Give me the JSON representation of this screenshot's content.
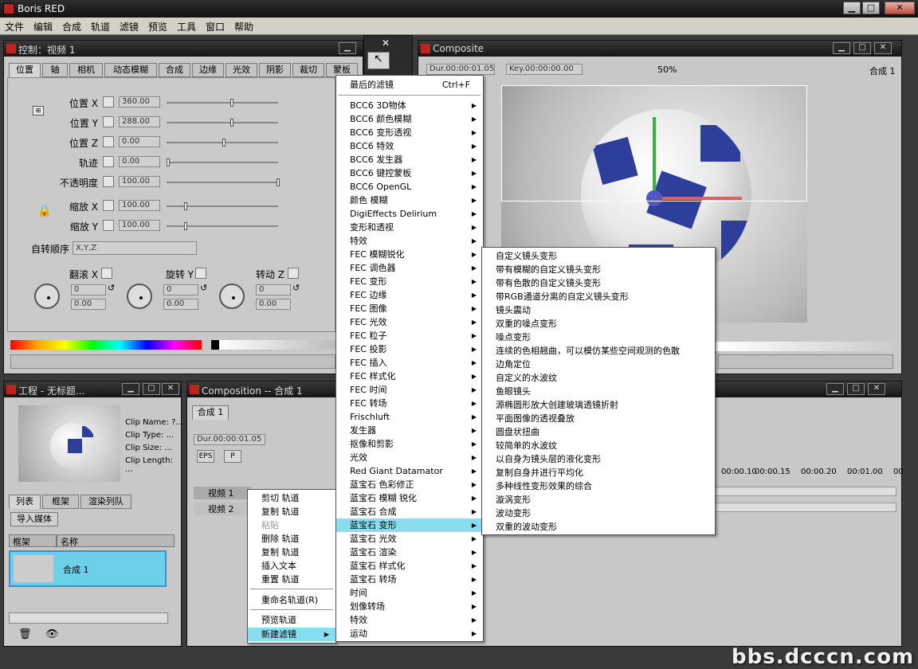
{
  "app": {
    "title": "Boris RED",
    "watermark": "bbs.dcccn.com"
  },
  "menubar": [
    "文件",
    "编辑",
    "合成",
    "轨道",
    "滤镜",
    "预览",
    "工具",
    "窗口",
    "帮助"
  ],
  "control": {
    "title": "控制：视频 1",
    "tabs": [
      "位置",
      "轴",
      "相机",
      "动态模糊",
      "合成",
      "边缘",
      "光效",
      "阴影",
      "裁切",
      "蒙板"
    ],
    "rows": [
      {
        "label": "位置 X",
        "value": "360.00"
      },
      {
        "label": "位置 Y",
        "value": "288.00"
      },
      {
        "label": "位置 Z",
        "value": "0.00"
      },
      {
        "label": "轨迹",
        "value": "0.00"
      },
      {
        "label": "不透明度",
        "value": "100.00"
      },
      {
        "label": "缩放 X",
        "value": "100.00"
      },
      {
        "label": "缩放 Y",
        "value": "100.00"
      }
    ],
    "rot_order_label": "自转顺序",
    "rot_order_value": "X,Y,Z",
    "spins": [
      {
        "label": "翻滚 X",
        "v1": "0",
        "v2": "0.00"
      },
      {
        "label": "旋转 Y",
        "v1": "0",
        "v2": "0.00"
      },
      {
        "label": "转动 Z",
        "v1": "0",
        "v2": "0.00"
      }
    ]
  },
  "composite": {
    "title": "Composite",
    "dur": "Dur.00:00:01.05",
    "key": "Key.00:00:00.00",
    "zoom": "50%",
    "comp": "合成 1"
  },
  "project": {
    "title": "工程 - 无标题...",
    "clip_name": "Clip Name:  ?..",
    "clip_type": "Clip Type:  ...",
    "clip_size": "Clip Size:  ...",
    "clip_length": "Clip Length: ...",
    "tabs": [
      "列表",
      "框架",
      "渲染列队"
    ],
    "import": "导入媒体",
    "col1": "框架",
    "col2": "名称",
    "item": "合成 1"
  },
  "composition": {
    "title": "Composition  --  合成 1",
    "tab": "合成 1",
    "dur": "Dur.00:00:01.05",
    "tracks": [
      "视频 1",
      "视频 2"
    ],
    "timecodes": [
      "00:00.10",
      "00:00.15",
      "00:00.20",
      "00:01.00",
      "00"
    ],
    "toolbar": [
      "EPS",
      "P"
    ]
  },
  "track_menu": {
    "items": [
      "剪切 轨道",
      "复制 轨道",
      "粘贴",
      "删除 轨道",
      "复制 轨道",
      "插入文本",
      "重置 轨道",
      "重命名轨道(R)",
      "预览轨道",
      "新建滤镜"
    ]
  },
  "filter_menu": {
    "first": "最后的滤镜",
    "shortcut": "Ctrl+F",
    "items": [
      "BCC6 3D物体",
      "BCC6 颜色模糊",
      "BCC6 变形透视",
      "BCC6 特效",
      "BCC6 发生器",
      "BCC6 键控蒙板",
      "BCC6 OpenGL",
      "颜色 模糊",
      "DigiEffects Delirium",
      "变形和透视",
      "特效",
      "FEC 模糊锐化",
      "FEC 调色器",
      "FEC 变形",
      "FEC 边缘",
      "FEC 图像",
      "FEC 光效",
      "FEC 粒子",
      "FEC 投影",
      "FEC 插入",
      "FEC 样式化",
      "FEC 时间",
      "FEC 转场",
      "Frischluft",
      "发生器",
      "抠像和剪影",
      "光效",
      "Red Giant Datamator",
      "蓝宝石 色彩修正",
      "蓝宝石 模糊 锐化",
      "蓝宝石 合成",
      "蓝宝石 变形",
      "蓝宝石 光效",
      "蓝宝石 渲染",
      "蓝宝石 样式化",
      "蓝宝石 转场",
      "时间",
      "划像转场",
      "特效",
      "运动"
    ]
  },
  "sub_menu": {
    "items": [
      "自定义镜头变形",
      "带有模糊的自定义镜头变形",
      "带有色散的自定义镜头变形",
      "带RGB通道分离的自定义镜头变形",
      "镜头震动",
      "双重的噪点变形",
      "噪点变形",
      "连续的色相翘曲，可以模仿某些空间观测的色散",
      "边角定位",
      "自定义的水波纹",
      "鱼眼镜头",
      "源椭圆形放大创建玻璃透镜折射",
      "平面图像的透视叠放",
      "圆盘状扭曲",
      "较简单的水波纹",
      "以自身为镜头层的液化变形",
      "复制自身并进行平均化",
      "多种线性变形效果的综合",
      "漩涡变形",
      "波动变形",
      "双重的波动变形"
    ]
  }
}
